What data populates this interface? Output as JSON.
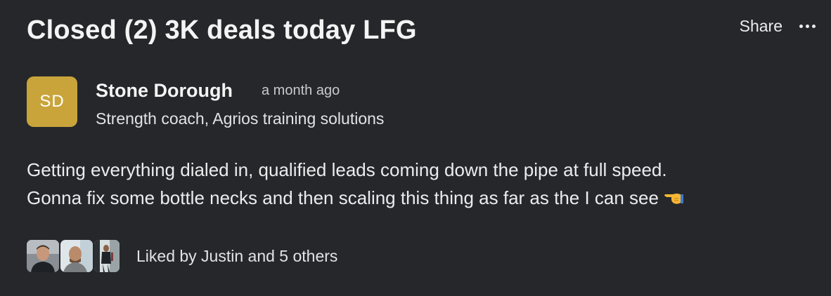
{
  "post": {
    "title": "Closed (2) 3K deals today LFG",
    "share_label": "Share",
    "more_icon": "more-horizontal-icon",
    "author": {
      "initials": "SD",
      "name": "Stone Dorough",
      "subtitle": "Strength coach, Agrios training solutions",
      "avatar_color": "#c9a43b"
    },
    "time": "a month ago",
    "body": {
      "line1": "Getting everything dialed in, qualified leads coming down the pipe at full speed.",
      "line2": "Gonna fix some bottle necks and then scaling this thing as far as the I can see",
      "emoji": "pointing-hand-emoji"
    },
    "likes": {
      "text": "Liked by Justin and 5 others",
      "avatars": [
        "liker-avatar-1",
        "liker-avatar-2",
        "liker-avatar-3"
      ]
    }
  },
  "colors": {
    "background": "#26272b",
    "text": "#ececee",
    "muted": "#c9c9cd"
  }
}
